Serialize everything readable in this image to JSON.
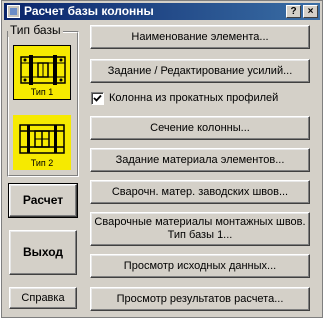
{
  "window": {
    "title": "Расчет базы колонны",
    "title_icon": "app-window-icon",
    "controls": {
      "help": "?",
      "close": "×"
    }
  },
  "base_type": {
    "group_label": "Тип базы",
    "types": [
      {
        "label": "Тип 1",
        "icon": "base-type-1-icon",
        "selected": true
      },
      {
        "label": "Тип 2",
        "icon": "base-type-2-icon",
        "selected": false
      }
    ]
  },
  "actions": {
    "element_name": "Наименование элемента...",
    "edit_forces": "Задание / Редактирование усилий...",
    "rolled_profiles_checkbox": {
      "label": "Колонна из прокатных профилей",
      "checked": true
    },
    "column_section": "Сечение колонны...",
    "element_material": "Задание материала элементов...",
    "factory_welds": "Сварочн. матер. заводских швов...",
    "field_welds_line1": "Сварочные материалы монтажных швов.",
    "field_welds_line2": "Тип базы 1...",
    "view_input": "Просмотр исходных данных...",
    "view_results": "Просмотр результатов расчета..."
  },
  "left_buttons": {
    "calculate": "Расчет",
    "exit": "Выход",
    "help": "Справка"
  },
  "colors": {
    "title_bar": "#0a246a",
    "tile_yellow": "#f6ea00",
    "dialog_face": "#d4d0c8"
  }
}
